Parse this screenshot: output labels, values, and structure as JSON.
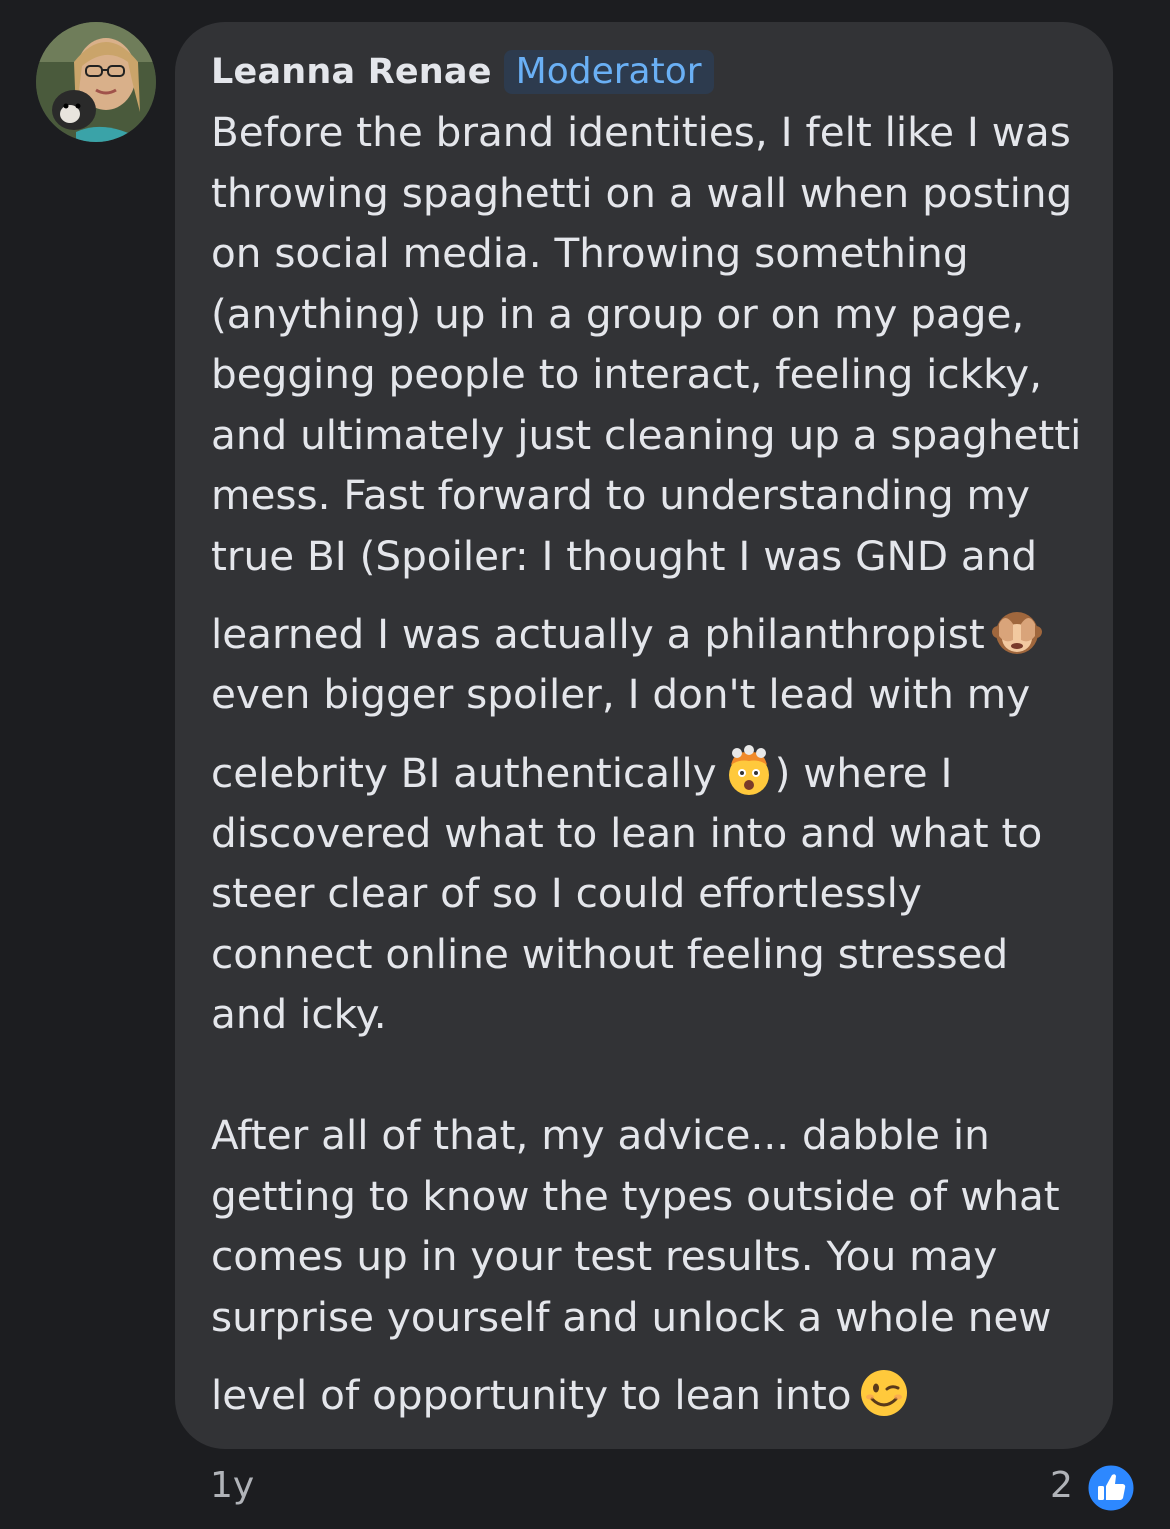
{
  "comment": {
    "author": "Leanna Renae",
    "badge": "Moderator",
    "avatar_icon": "profile-photo-avatar",
    "lines": [
      "Before the brand identities, I felt like I was",
      "throwing spaghetti on a wall when posting",
      "on social media. Throwing something",
      "(anything) up in a group or on my page,",
      "begging people to interact, feeling ickky,",
      "and ultimately just cleaning up a spaghetti",
      "mess. Fast forward to understanding my",
      "true BI (Spoiler: I thought I was GND and",
      "learned I was actually a philanthropist",
      "even bigger spoiler, I don't lead with my",
      "celebrity BI authentically",
      ") where I",
      "discovered what to lean into and what to",
      "steer clear of so I could effortlessly",
      "connect online without feeling stressed",
      "and icky.",
      "After all of that, my advice... dabble in",
      "getting to know the types outside of what",
      "comes up in your test results. You may",
      "surprise yourself and unlock a whole new",
      "level of opportunity to lean into"
    ],
    "emojis": {
      "see_no_evil": "see-no-evil-monkey-emoji",
      "mind_blown": "exploding-head-emoji",
      "wink": "winking-face-emoji"
    }
  },
  "footer": {
    "timestamp": "1y",
    "reaction_count": "2",
    "reaction_icon": "like-thumb-icon",
    "reaction_color": "#2d88ff"
  }
}
